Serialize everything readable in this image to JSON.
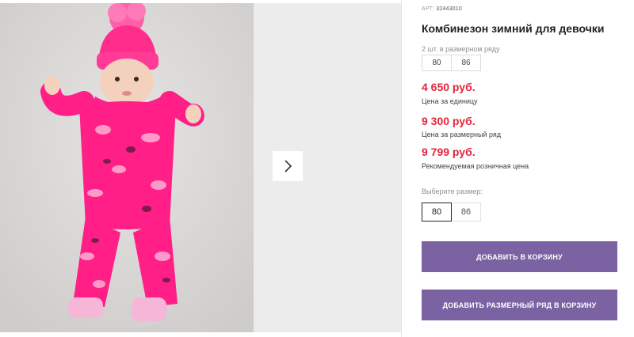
{
  "gallery": {
    "next_icon": "chevron-right-icon"
  },
  "product": {
    "sku_label": "АРТ:",
    "sku_value": "32443010",
    "title": "Комбинезон зимний для девочки",
    "row_label": "2 шт. в размерном ряду",
    "row_sizes": [
      "80",
      "86"
    ],
    "prices": [
      {
        "value": "4 650 руб.",
        "note": "Цена за единицу"
      },
      {
        "value": "9 300 руб.",
        "note": "Цена за размерный ряд"
      },
      {
        "value": "9 799 руб.",
        "note": "Рекомендуемая розничная цена"
      }
    ],
    "choose_label": "Выберите размер:",
    "choose_sizes": [
      "80",
      "86"
    ],
    "selected_size": "80"
  },
  "actions": {
    "add_to_cart": "ДОБАВИТЬ В КОРЗИНУ",
    "add_row_to_cart": "ДОБАВИТЬ РАЗМЕРНЫЙ РЯД В КОРЗИНУ"
  },
  "colors": {
    "accent": "#7b62a3",
    "price": "#e5243b"
  }
}
